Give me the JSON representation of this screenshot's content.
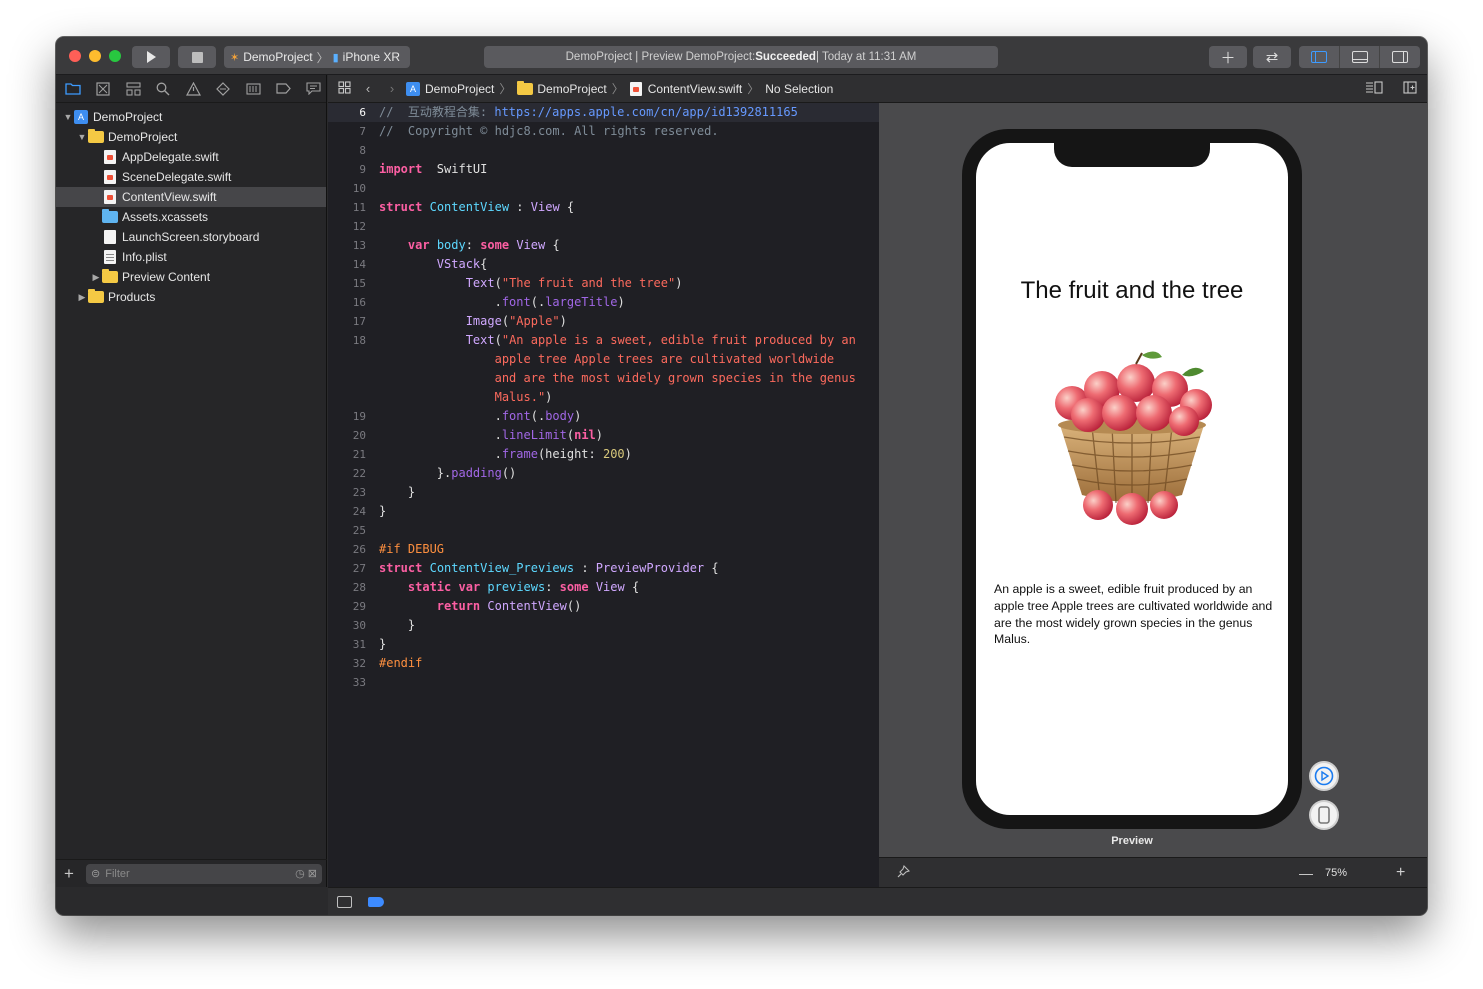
{
  "toolbar": {
    "scheme_project": "DemoProject",
    "scheme_device": "iPhone XR",
    "status_prefix": "DemoProject | Preview DemoProject: ",
    "status_result": "Succeeded",
    "status_time": " | Today at 11:31 AM"
  },
  "navigator": {
    "items": [
      {
        "label": "DemoProject",
        "kind": "project",
        "depth": 0,
        "expanded": true
      },
      {
        "label": "DemoProject",
        "kind": "folder",
        "depth": 1,
        "expanded": true
      },
      {
        "label": "AppDelegate.swift",
        "kind": "swift",
        "depth": 2
      },
      {
        "label": "SceneDelegate.swift",
        "kind": "swift",
        "depth": 2
      },
      {
        "label": "ContentView.swift",
        "kind": "swift",
        "depth": 2,
        "selected": true
      },
      {
        "label": "Assets.xcassets",
        "kind": "assets",
        "depth": 2
      },
      {
        "label": "LaunchScreen.storyboard",
        "kind": "storyboard",
        "depth": 2
      },
      {
        "label": "Info.plist",
        "kind": "plist",
        "depth": 2
      },
      {
        "label": "Preview Content",
        "kind": "folder",
        "depth": 2,
        "expanded": false
      },
      {
        "label": "Products",
        "kind": "folder",
        "depth": 1,
        "expanded": false
      }
    ],
    "filter_placeholder": "Filter"
  },
  "jumpbar": {
    "crumbs": [
      "DemoProject",
      "DemoProject",
      "ContentView.swift",
      "No Selection"
    ]
  },
  "editor": {
    "current_line": 6,
    "lines": [
      {
        "n": "6",
        "t": [
          [
            "cm",
            "//  互动教程合集: "
          ],
          [
            "url",
            "https://apps.apple.com/cn/app/id1392811165"
          ]
        ]
      },
      {
        "n": "7",
        "t": [
          [
            "cm",
            "//  Copyright © hdjc8.com. All rights reserved."
          ]
        ]
      },
      {
        "n": "8",
        "t": []
      },
      {
        "n": "9",
        "t": [
          [
            "kw",
            "import"
          ],
          [
            "",
            "  SwiftUI"
          ]
        ]
      },
      {
        "n": "10",
        "t": []
      },
      {
        "n": "11",
        "t": [
          [
            "kw",
            "struct"
          ],
          [
            "",
            " "
          ],
          [
            "ty2",
            "ContentView"
          ],
          [
            "",
            " : "
          ],
          [
            "ty",
            "View"
          ],
          [
            "",
            " {"
          ]
        ]
      },
      {
        "n": "12",
        "t": []
      },
      {
        "n": "13",
        "t": [
          [
            "",
            "    "
          ],
          [
            "kw",
            "var"
          ],
          [
            "",
            " "
          ],
          [
            "ty2",
            "body"
          ],
          [
            "",
            ": "
          ],
          [
            "kw",
            "some"
          ],
          [
            "",
            " "
          ],
          [
            "ty",
            "View"
          ],
          [
            "",
            " {"
          ]
        ]
      },
      {
        "n": "14",
        "t": [
          [
            "",
            "        "
          ],
          [
            "ty",
            "VStack"
          ],
          [
            "",
            "{"
          ]
        ]
      },
      {
        "n": "15",
        "t": [
          [
            "",
            "            "
          ],
          [
            "ty",
            "Text"
          ],
          [
            "",
            "("
          ],
          [
            "st",
            "\"The fruit and the tree\""
          ],
          [
            "",
            ")"
          ]
        ]
      },
      {
        "n": "16",
        "t": [
          [
            "",
            "                ."
          ],
          [
            "fn",
            "font"
          ],
          [
            "",
            "(."
          ],
          [
            "fn",
            "largeTitle"
          ],
          [
            "",
            ")"
          ]
        ]
      },
      {
        "n": "17",
        "t": [
          [
            "",
            "            "
          ],
          [
            "ty",
            "Image"
          ],
          [
            "",
            "("
          ],
          [
            "st",
            "\"Apple\""
          ],
          [
            "",
            ")"
          ]
        ]
      },
      {
        "n": "18",
        "t": [
          [
            "",
            "            "
          ],
          [
            "ty",
            "Text"
          ],
          [
            "",
            "("
          ],
          [
            "st",
            "\"An apple is a sweet, edible fruit produced by an"
          ]
        ]
      },
      {
        "n": "",
        "t": [
          [
            "",
            "                "
          ],
          [
            "st",
            "apple tree Apple trees are cultivated worldwide"
          ]
        ]
      },
      {
        "n": "",
        "t": [
          [
            "",
            "                "
          ],
          [
            "st",
            "and are the most widely grown species in the genus"
          ]
        ]
      },
      {
        "n": "",
        "t": [
          [
            "",
            "                "
          ],
          [
            "st",
            "Malus.\""
          ],
          [
            "",
            ")"
          ]
        ]
      },
      {
        "n": "19",
        "t": [
          [
            "",
            "                ."
          ],
          [
            "fn",
            "font"
          ],
          [
            "",
            "(."
          ],
          [
            "fn",
            "body"
          ],
          [
            "",
            ")"
          ]
        ]
      },
      {
        "n": "20",
        "t": [
          [
            "",
            "                ."
          ],
          [
            "fn",
            "lineLimit"
          ],
          [
            "",
            "("
          ],
          [
            "kw",
            "nil"
          ],
          [
            "",
            ")"
          ]
        ]
      },
      {
        "n": "21",
        "t": [
          [
            "",
            "                ."
          ],
          [
            "fn",
            "frame"
          ],
          [
            "",
            "(height: "
          ],
          [
            "nm",
            "200"
          ],
          [
            "",
            ")"
          ]
        ]
      },
      {
        "n": "22",
        "t": [
          [
            "",
            "        }."
          ],
          [
            "fn",
            "padding"
          ],
          [
            "",
            "()"
          ]
        ]
      },
      {
        "n": "23",
        "t": [
          [
            "",
            "    }"
          ]
        ]
      },
      {
        "n": "24",
        "t": [
          [
            "",
            "}"
          ]
        ]
      },
      {
        "n": "25",
        "t": []
      },
      {
        "n": "26",
        "t": [
          [
            "pp",
            "#if DEBUG"
          ]
        ]
      },
      {
        "n": "27",
        "t": [
          [
            "kw",
            "struct"
          ],
          [
            "",
            " "
          ],
          [
            "ty2",
            "ContentView_Previews"
          ],
          [
            "",
            " : "
          ],
          [
            "ty",
            "PreviewProvider"
          ],
          [
            "",
            " {"
          ]
        ]
      },
      {
        "n": "28",
        "t": [
          [
            "",
            "    "
          ],
          [
            "kw",
            "static"
          ],
          [
            "",
            " "
          ],
          [
            "kw",
            "var"
          ],
          [
            "",
            " "
          ],
          [
            "ty2",
            "previews"
          ],
          [
            "",
            ": "
          ],
          [
            "kw",
            "some"
          ],
          [
            "",
            " "
          ],
          [
            "ty",
            "View"
          ],
          [
            "",
            " {"
          ]
        ]
      },
      {
        "n": "29",
        "t": [
          [
            "",
            "        "
          ],
          [
            "kw",
            "return"
          ],
          [
            "",
            " "
          ],
          [
            "ty",
            "ContentView"
          ],
          [
            "",
            "()"
          ]
        ]
      },
      {
        "n": "30",
        "t": [
          [
            "",
            "    }"
          ]
        ]
      },
      {
        "n": "31",
        "t": [
          [
            "",
            "}"
          ]
        ]
      },
      {
        "n": "32",
        "t": [
          [
            "pp",
            "#endif"
          ]
        ]
      },
      {
        "n": "33",
        "t": []
      }
    ]
  },
  "preview": {
    "title": "The fruit and the tree",
    "body": "An apple is a sweet, edible fruit produced by an apple tree Apple trees are cultivated worldwide and are the most widely grown species in the genus Malus.",
    "label": "Preview",
    "zoom": "75%"
  },
  "colors": {
    "accent": "#3d9bff",
    "selection": "#464649"
  }
}
